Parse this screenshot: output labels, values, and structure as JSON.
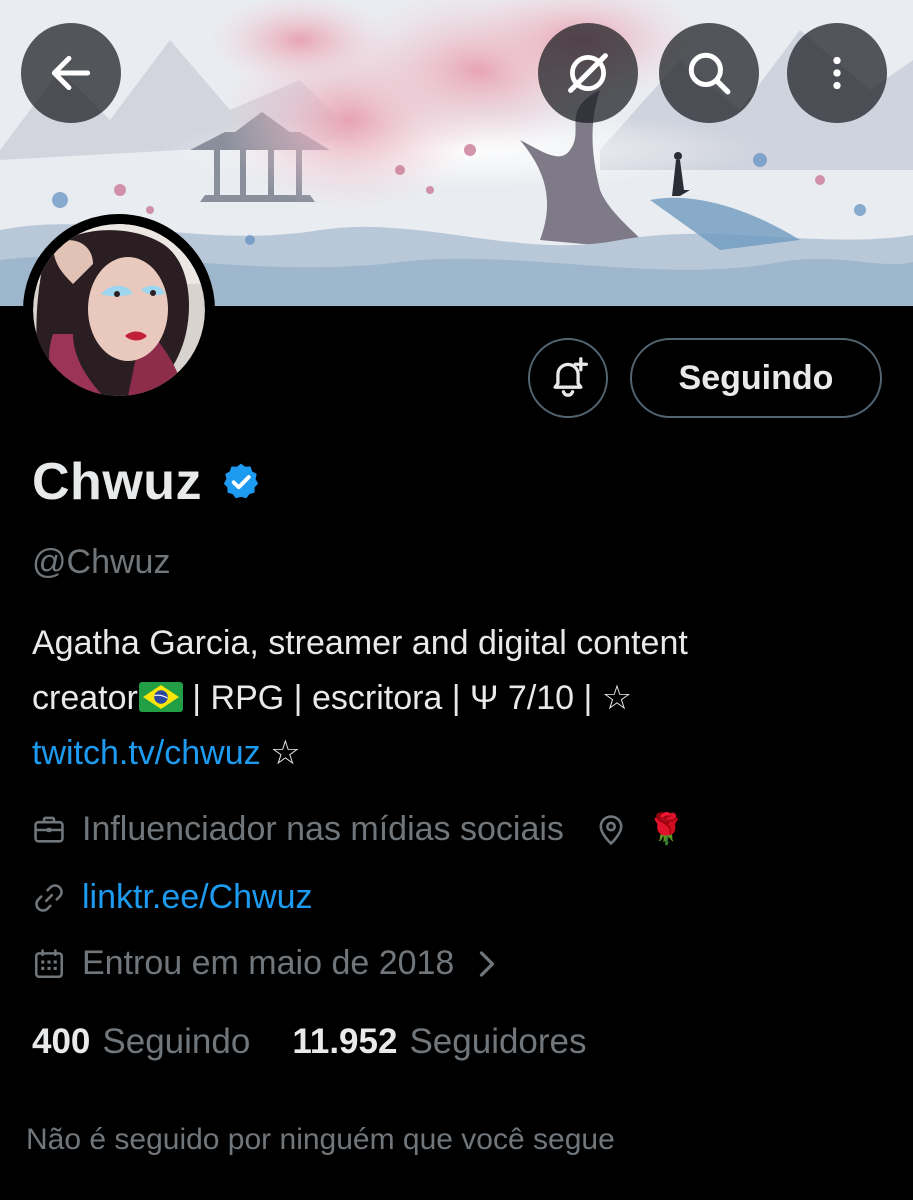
{
  "colors": {
    "background": "#000000",
    "text_primary": "#e7e9ea",
    "text_secondary": "#71767b",
    "link": "#1d9bf0",
    "verified": "#1d9bf0",
    "button_border": "#536471"
  },
  "header": {
    "back_icon": "arrow-left-icon",
    "grok_icon": "grok-icon",
    "search_icon": "search-icon",
    "more_icon": "more-vertical-icon"
  },
  "profile": {
    "display_name": "Chwuz",
    "verified": true,
    "handle": "@Chwuz",
    "follow_button_label": "Seguindo",
    "notify_icon": "bell-plus-icon",
    "bio_line1": "Agatha Garcia, streamer and digital content",
    "bio_line2_prefix": "creator",
    "bio_line2_suffix": "| RPG  |  escritora  | Ψ 7/10 | ☆",
    "bio_link": "twitch.tv/chwuz",
    "bio_link_suffix": " ☆",
    "profession": "Influenciador nas mídias sociais",
    "location_emoji": "🌹",
    "website": "linktr.ee/Chwuz",
    "joined": "Entrou em maio de 2018",
    "following_count": "400",
    "following_label": "Seguindo",
    "followers_count": "11.952",
    "followers_label": "Seguidores",
    "followed_by_note": "Não é seguido por ninguém que você segue"
  }
}
